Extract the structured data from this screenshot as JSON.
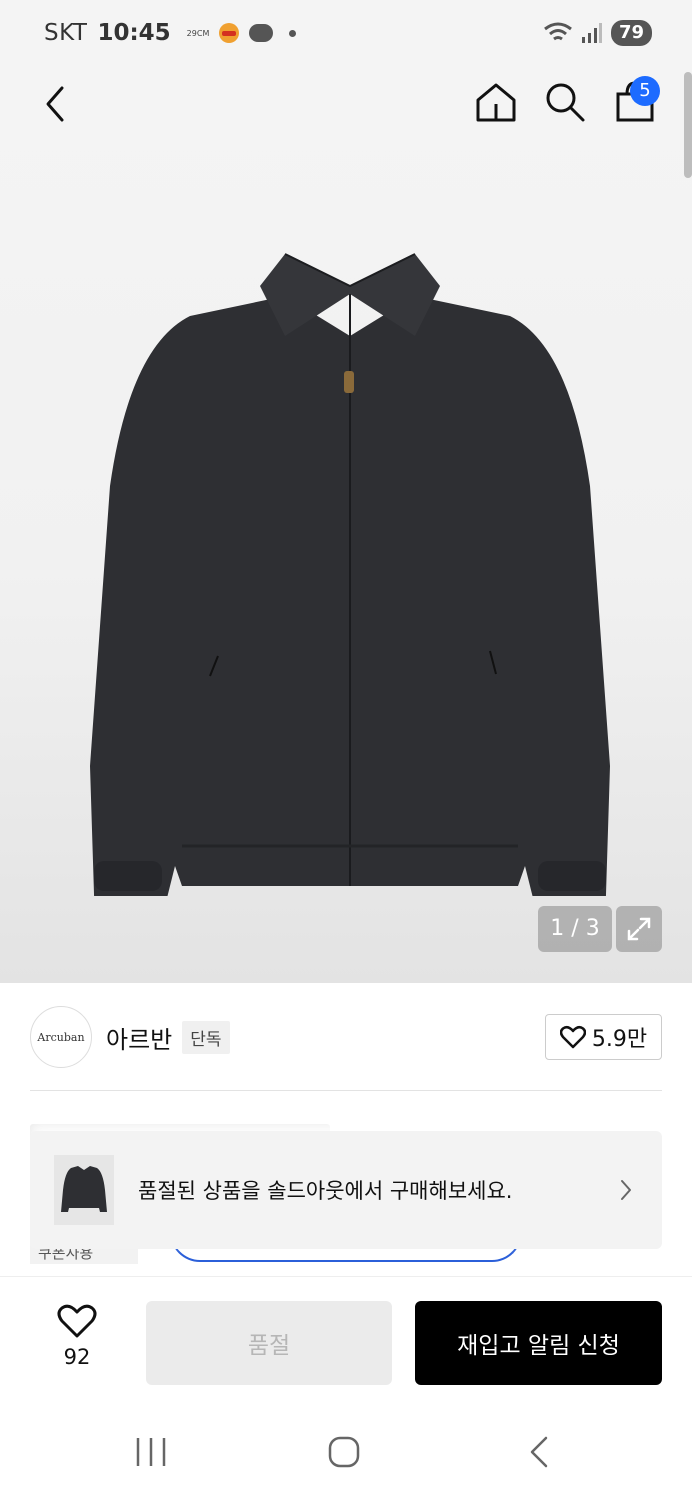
{
  "status_bar": {
    "carrier": "SKT",
    "time": "10:45",
    "temp_app": "29CM",
    "battery": "79"
  },
  "header": {
    "cart_count": "5"
  },
  "gallery": {
    "counter": "1 / 3"
  },
  "brand": {
    "logo_text": "Arcuban",
    "name": "아르반",
    "badge": "단독",
    "likes": "5.9만"
  },
  "promo": {
    "coupon_tag": "쿠폰사용"
  },
  "toast": {
    "text": "품절된 상품을 솔드아웃에서 구매해보세요."
  },
  "action_bar": {
    "wish_count": "92",
    "soldout_label": "품절",
    "restock_label": "재입고 알림 신청"
  }
}
